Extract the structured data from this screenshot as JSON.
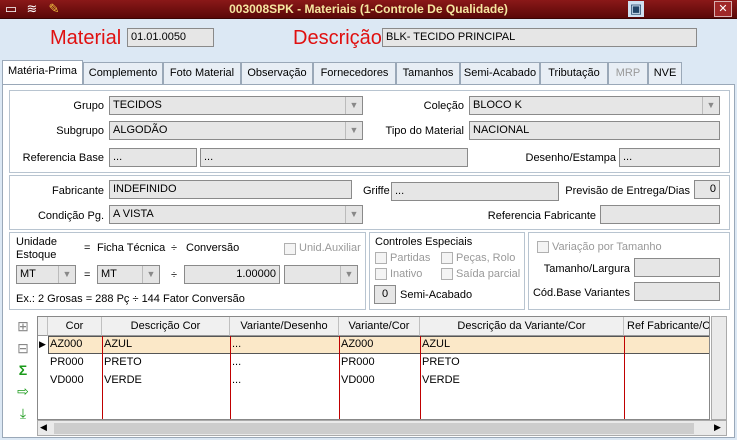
{
  "window": {
    "title": "003008SPK - Materiais (1-Controle De Qualidade)",
    "close": "✕"
  },
  "header": {
    "material_label": "Material",
    "material_value": "01.01.0050",
    "descricao_label": "Descrição",
    "descricao_value": "BLK- TECIDO PRINCIPAL"
  },
  "tabs": [
    "Matéria-Prima",
    "Complemento",
    "Foto Material",
    "Observação",
    "Fornecedores",
    "Tamanhos",
    "Semi-Acabado",
    "Tributação",
    "MRP",
    "NVE"
  ],
  "form": {
    "grupo_label": "Grupo",
    "grupo_value": "TECIDOS",
    "subgrupo_label": "Subgrupo",
    "subgrupo_value": "ALGODÃO",
    "refbase_label": "Referencia Base",
    "refbase_value1": "...",
    "refbase_value2": "...",
    "colecao_label": "Coleção",
    "colecao_value": "BLOCO K",
    "tipo_label": "Tipo do Material",
    "tipo_value": "NACIONAL",
    "desenho_label": "Desenho/Estampa",
    "desenho_value": "...",
    "fabricante_label": "Fabricante",
    "fabricante_value": "INDEFINIDO",
    "griffe_label": "Griffe",
    "griffe_value": "...",
    "previsao_label": "Previsão de Entrega/Dias",
    "previsao_value": "0",
    "condicao_label": "Condição Pg.",
    "condicao_value": "A VISTA",
    "reffab_label": "Referencia Fabricante",
    "reffab_value": ""
  },
  "unidade": {
    "unidade_label": "Unidade",
    "estoque_label": "Estoque",
    "eq1": "=",
    "ficha_label": "Ficha Técnica",
    "div1": "÷",
    "conversao_label": "Conversão",
    "aux_label": "Unid.Auxiliar",
    "unid_estoque": "MT",
    "eq2": "=",
    "unid_ficha": "MT",
    "div2": "÷",
    "conversao_value": "1.00000",
    "unid_aux": "",
    "example": "Ex.:  2 Grosas  =  288 Pç   ÷   144  Fator Conversão"
  },
  "controles": {
    "title": "Controles Especiais",
    "partidas": "Partidas",
    "pecas": "Peças, Rolo",
    "inativo": "Inativo",
    "saida": "Saída parcial",
    "semi_value": "0",
    "semi_label": "Semi-Acabado"
  },
  "variacao": {
    "label": "Variação por Tamanho",
    "tamanho_label": "Tamanho/Largura",
    "tamanho_value": "",
    "codbase_label": "Cód.Base Variantes",
    "codbase_value": ""
  },
  "grid": {
    "columns": [
      "Cor",
      "Descrição Cor",
      "Variante/Desenho",
      "Variante/Cor",
      "Descrição da Variante/Cor",
      "Ref Fabricante/Cor"
    ],
    "rows": [
      [
        "AZ000",
        "AZUL",
        "...",
        "AZ000",
        "AZUL",
        ""
      ],
      [
        "PR000",
        "PRETO",
        "...",
        "PR000",
        "PRETO",
        ""
      ],
      [
        "VD000",
        "VERDE",
        "...",
        "VD000",
        "VERDE",
        ""
      ]
    ]
  },
  "colors": {
    "titlebar": "#7a1010",
    "title_text": "#f5e6a0",
    "label_red": "#e01010",
    "selected_row": "#fbe8c8"
  }
}
